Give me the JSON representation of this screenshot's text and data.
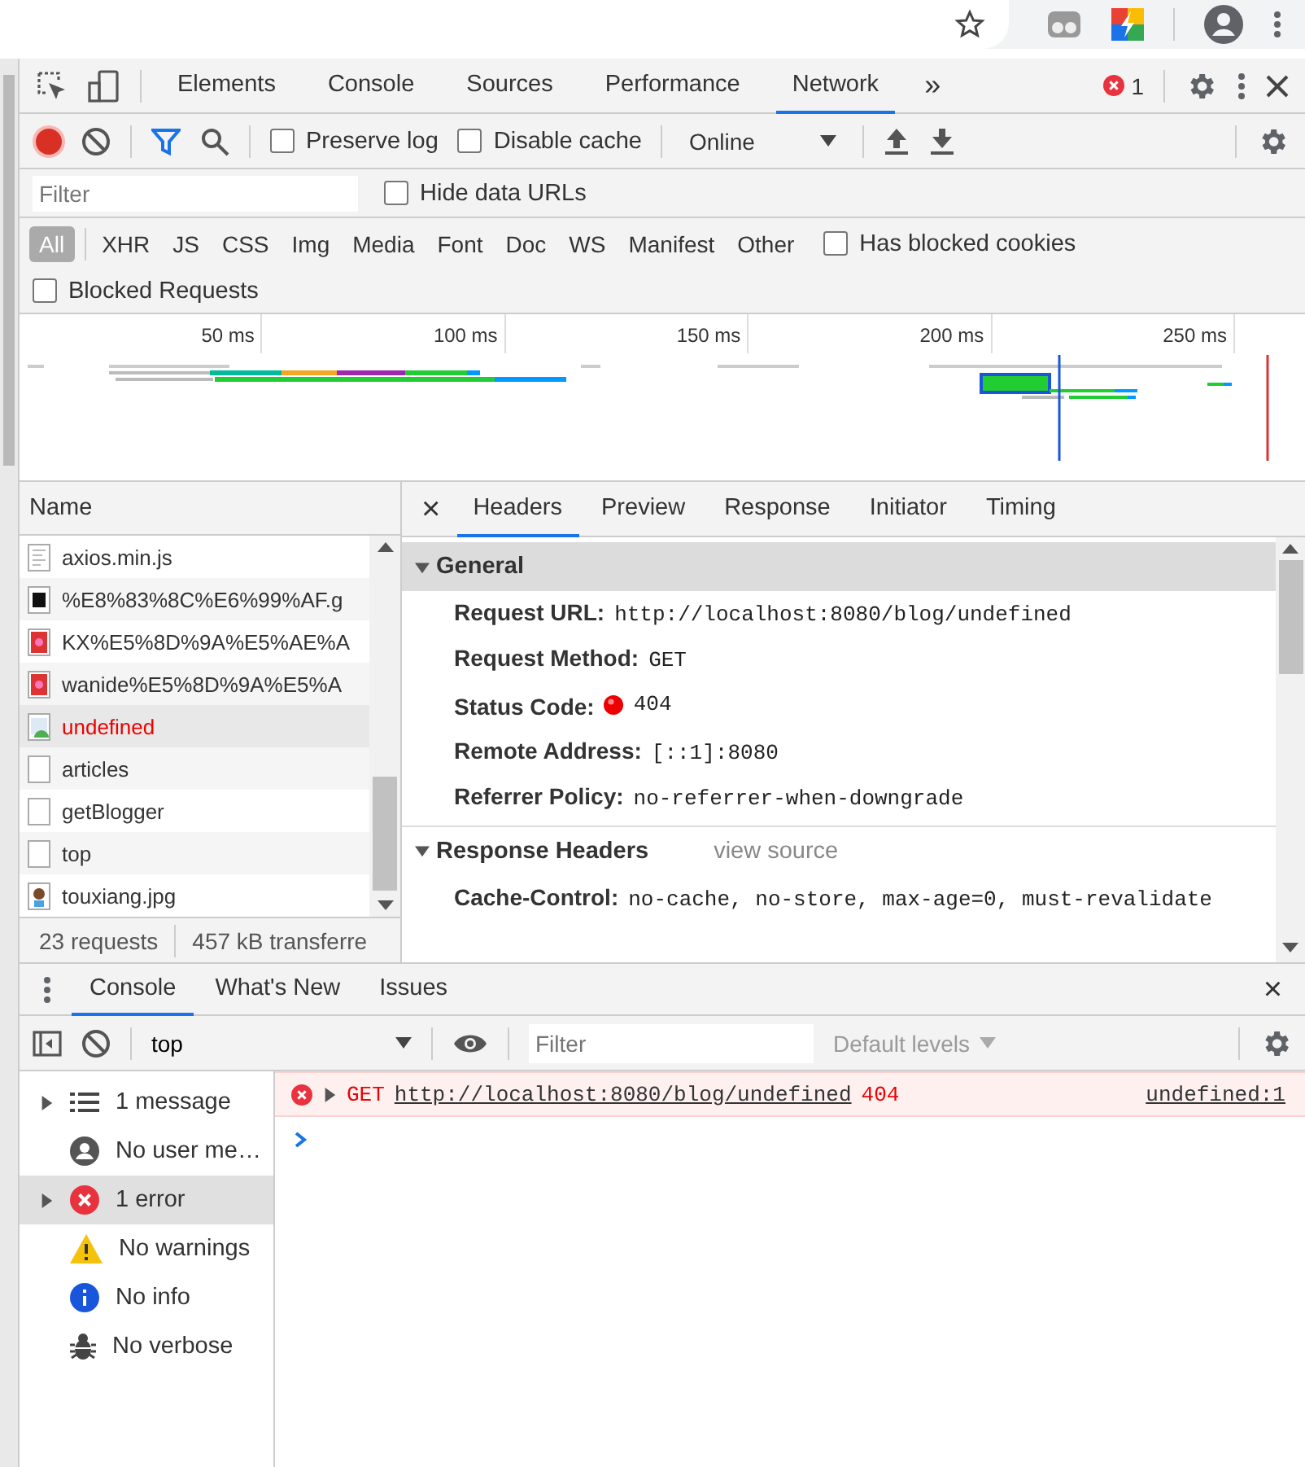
{
  "devtools": {
    "tabs": [
      {
        "label": "Elements",
        "selected": false
      },
      {
        "label": "Console",
        "selected": false
      },
      {
        "label": "Sources",
        "selected": false
      },
      {
        "label": "Performance",
        "selected": false
      },
      {
        "label": "Network",
        "selected": true
      }
    ],
    "more_tabs": "»",
    "error_count": "1"
  },
  "network_toolbar": {
    "recording": true,
    "checkboxes": [
      {
        "label": "Preserve log",
        "checked": false
      },
      {
        "label": "Disable cache",
        "checked": false
      }
    ],
    "throttling": "Online"
  },
  "filter_bar": {
    "placeholder": "Filter",
    "hide_data_urls": {
      "label": "Hide data URLs",
      "checked": false
    },
    "types": [
      {
        "label": "All",
        "selected": true
      },
      {
        "label": "XHR",
        "selected": false
      },
      {
        "label": "JS",
        "selected": false
      },
      {
        "label": "CSS",
        "selected": false
      },
      {
        "label": "Img",
        "selected": false
      },
      {
        "label": "Media",
        "selected": false
      },
      {
        "label": "Font",
        "selected": false
      },
      {
        "label": "Doc",
        "selected": false
      },
      {
        "label": "WS",
        "selected": false
      },
      {
        "label": "Manifest",
        "selected": false
      },
      {
        "label": "Other",
        "selected": false
      }
    ],
    "has_blocked_cookies": {
      "label": "Has blocked cookies",
      "checked": false
    },
    "blocked_requests": {
      "label": "Blocked Requests",
      "checked": false
    }
  },
  "overview": {
    "ticks": [
      "50 ms",
      "100 ms",
      "150 ms",
      "200 ms",
      "250 ms"
    ]
  },
  "requests": {
    "header": "Name",
    "rows": [
      {
        "name": "axios.min.js",
        "kind": "script",
        "error": false,
        "selected": false
      },
      {
        "name": "%E8%83%8C%E6%99%AF.g",
        "kind": "dark-image",
        "error": false,
        "selected": false
      },
      {
        "name": "KX%E5%8D%9A%E5%AE%A",
        "kind": "red-image",
        "error": false,
        "selected": false
      },
      {
        "name": "wanide%E5%8D%9A%E5%A",
        "kind": "red-image",
        "error": false,
        "selected": false
      },
      {
        "name": "undefined",
        "kind": "broken-image",
        "error": true,
        "selected": true
      },
      {
        "name": "articles",
        "kind": "document",
        "error": false,
        "selected": false
      },
      {
        "name": "getBlogger",
        "kind": "document",
        "error": false,
        "selected": false
      },
      {
        "name": "top",
        "kind": "document",
        "error": false,
        "selected": false
      },
      {
        "name": "touxiang.jpg",
        "kind": "avatar-image",
        "error": false,
        "selected": false
      }
    ],
    "summary": [
      "23 requests",
      "457 kB transferre"
    ]
  },
  "details": {
    "close": "×",
    "tabs": [
      {
        "label": "Headers",
        "selected": true
      },
      {
        "label": "Preview",
        "selected": false
      },
      {
        "label": "Response",
        "selected": false
      },
      {
        "label": "Initiator",
        "selected": false
      },
      {
        "label": "Timing",
        "selected": false
      }
    ],
    "sections": [
      {
        "title": "General",
        "expanded": true,
        "highlighted": true,
        "fields": [
          {
            "label": "Request URL:",
            "value": "http://localhost:8080/blog/undefined",
            "kind": "text"
          },
          {
            "label": "Request Method:",
            "value": "GET",
            "kind": "text"
          },
          {
            "label": "Status Code:",
            "value": "404",
            "kind": "status"
          },
          {
            "label": "Remote Address:",
            "value": "[::1]:8080",
            "kind": "text"
          },
          {
            "label": "Referrer Policy:",
            "value": "no-referrer-when-downgrade",
            "kind": "text"
          }
        ]
      },
      {
        "title": "Response Headers",
        "link": "view source",
        "expanded": true,
        "highlighted": false,
        "fields": [
          {
            "label": "Cache-Control:",
            "value": "no-cache, no-store, max-age=0, must-revalidate",
            "kind": "text"
          }
        ]
      }
    ]
  },
  "console": {
    "tabs": [
      {
        "label": "Console",
        "selected": true
      },
      {
        "label": "What's New",
        "selected": false
      },
      {
        "label": "Issues",
        "selected": false
      }
    ],
    "close": "×",
    "context": "top",
    "filter_placeholder": "Filter",
    "levels": "Default levels",
    "sidebar": [
      {
        "label": "1 message",
        "kind": "messages",
        "expandable": true,
        "selected": false
      },
      {
        "label": "No user me…",
        "kind": "user",
        "expandable": false,
        "selected": false
      },
      {
        "label": "1 error",
        "kind": "error",
        "expandable": true,
        "selected": true
      },
      {
        "label": "No warnings",
        "kind": "warning",
        "expandable": false,
        "selected": false
      },
      {
        "label": "No info",
        "kind": "info",
        "expandable": false,
        "selected": false
      },
      {
        "label": "No verbose",
        "kind": "verbose",
        "expandable": false,
        "selected": false
      }
    ],
    "messages": [
      {
        "error": true,
        "method": "GET",
        "url": "http://localhost:8080/blog/undefined",
        "status": "404",
        "source": "undefined:1"
      }
    ]
  }
}
